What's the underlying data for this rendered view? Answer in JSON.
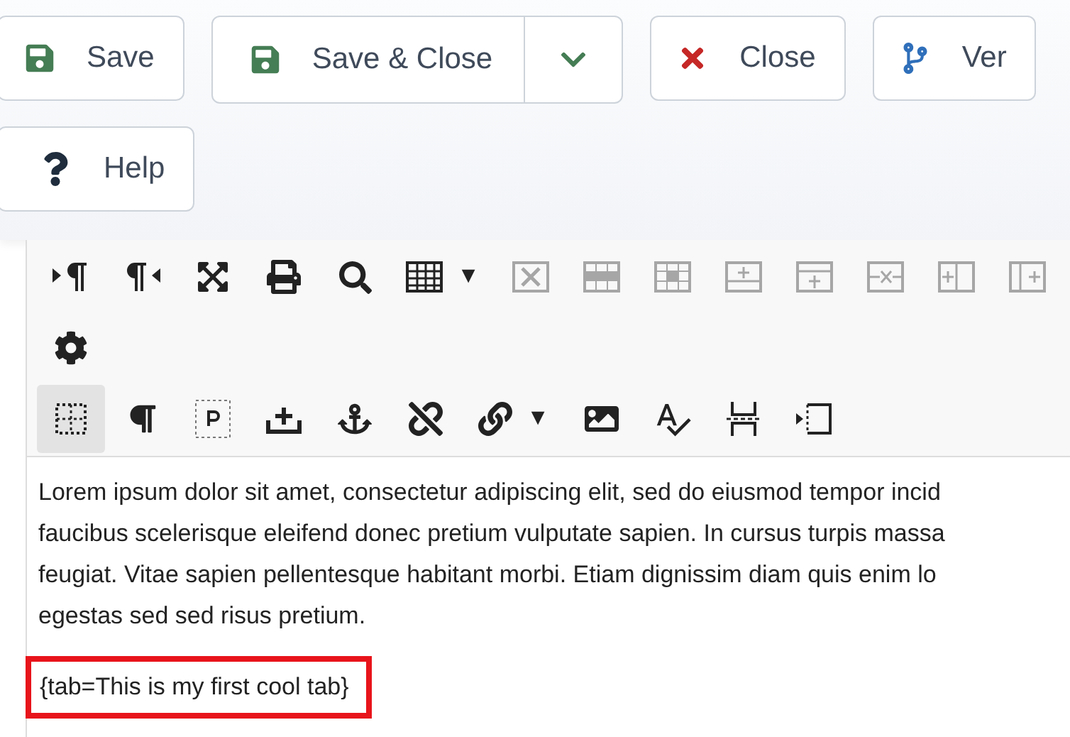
{
  "actions": {
    "rows": [
      [
        {
          "kind": "save",
          "label": "Save"
        },
        {
          "kind": "split",
          "label": "Save & Close"
        },
        {
          "kind": "close",
          "label": "Close"
        },
        {
          "kind": "versions",
          "label": "Ver"
        }
      ],
      [
        {
          "kind": "help",
          "label": "Help"
        }
      ]
    ]
  },
  "editor": {
    "toolbar_rows": [
      [
        {
          "kind": "button",
          "disabled": false,
          "on": false
        },
        {
          "kind": "button",
          "disabled": false,
          "on": false
        },
        {
          "kind": "button",
          "disabled": false,
          "on": false
        },
        {
          "kind": "button",
          "disabled": false,
          "on": false
        },
        {
          "kind": "button",
          "disabled": false,
          "on": false
        },
        {
          "kind": "menu",
          "arrow": "▼",
          "disabled": false,
          "on": false
        },
        {
          "kind": "button",
          "disabled": true,
          "on": false
        },
        {
          "kind": "button",
          "disabled": true,
          "on": false
        },
        {
          "kind": "button",
          "disabled": true,
          "on": false
        },
        {
          "kind": "button",
          "disabled": true,
          "on": false
        },
        {
          "kind": "button",
          "disabled": true,
          "on": false
        },
        {
          "kind": "button",
          "disabled": true,
          "on": false
        },
        {
          "kind": "button",
          "disabled": true,
          "on": false
        },
        {
          "kind": "button",
          "disabled": true,
          "on": false
        }
      ],
      [
        {
          "kind": "button",
          "disabled": false,
          "on": false
        }
      ],
      [
        {
          "kind": "button",
          "disabled": false,
          "on": true
        },
        {
          "kind": "button",
          "disabled": false,
          "on": false
        },
        {
          "kind": "button",
          "disabled": false,
          "on": false
        },
        {
          "kind": "button",
          "disabled": false,
          "on": false
        },
        {
          "kind": "button",
          "disabled": false,
          "on": false
        },
        {
          "kind": "button",
          "disabled": false,
          "on": false
        },
        {
          "kind": "menu",
          "arrow": "▼",
          "disabled": false,
          "on": false
        },
        {
          "kind": "button",
          "disabled": false,
          "on": false
        },
        {
          "kind": "button",
          "disabled": false,
          "on": false
        },
        {
          "kind": "button",
          "disabled": false,
          "on": false
        },
        {
          "kind": "button",
          "disabled": false,
          "on": false
        }
      ]
    ],
    "paragraph_lines": [
      "Lorem ipsum dolor sit amet, consectetur adipiscing elit, sed do eiusmod tempor incid",
      "faucibus scelerisque eleifend donec pretium vulputate sapien. In cursus turpis massa",
      "feugiat. Vitae sapien pellentesque habitant morbi. Etiam dignissim diam quis enim lo",
      "egestas sed sed risus pretium."
    ],
    "highlighted_line": "{tab=This is my first cool tab}"
  }
}
